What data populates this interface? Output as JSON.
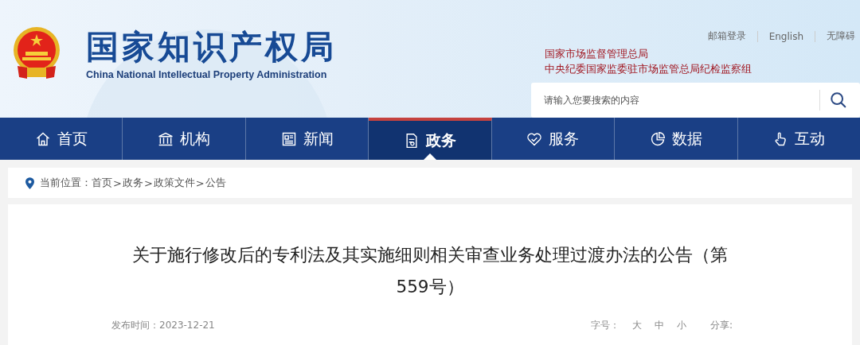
{
  "header": {
    "title": "国家知识产权局",
    "subtitle": "China National Intellectual Property Administration",
    "top_links": [
      "邮箱登录",
      "English",
      "无障碍"
    ],
    "affiliations": [
      "国家市场监督管理总局",
      "中央纪委国家监委驻市场监管总局纪检监察组"
    ],
    "search": {
      "placeholder": "请输入您要搜索的内容"
    }
  },
  "nav": [
    {
      "label": "首页",
      "selected": false
    },
    {
      "label": "机构",
      "selected": false
    },
    {
      "label": "新闻",
      "selected": false
    },
    {
      "label": "政务",
      "selected": true
    },
    {
      "label": "服务",
      "selected": false
    },
    {
      "label": "数据",
      "selected": false
    },
    {
      "label": "互动",
      "selected": false
    }
  ],
  "breadcrumb": {
    "label": "当前位置：",
    "items": [
      {
        "kind": "link",
        "text": "首页"
      },
      {
        "kind": "separator",
        "text": ">"
      },
      {
        "kind": "link",
        "text": "政务"
      },
      {
        "kind": "separator",
        "text": ">"
      },
      {
        "kind": "link",
        "text": "政策文件"
      },
      {
        "kind": "separator",
        "text": ">"
      },
      {
        "kind": "link",
        "text": "公告"
      }
    ]
  },
  "article": {
    "title": "关于施行修改后的专利法及其实施细则相关审查业务处理过渡办法的公告（第559号）",
    "date": "发布时间：2023-12-21",
    "font_size_label": "字号：",
    "font_sizes": [
      "大",
      "中",
      "小"
    ],
    "share_label": "分享:"
  }
}
